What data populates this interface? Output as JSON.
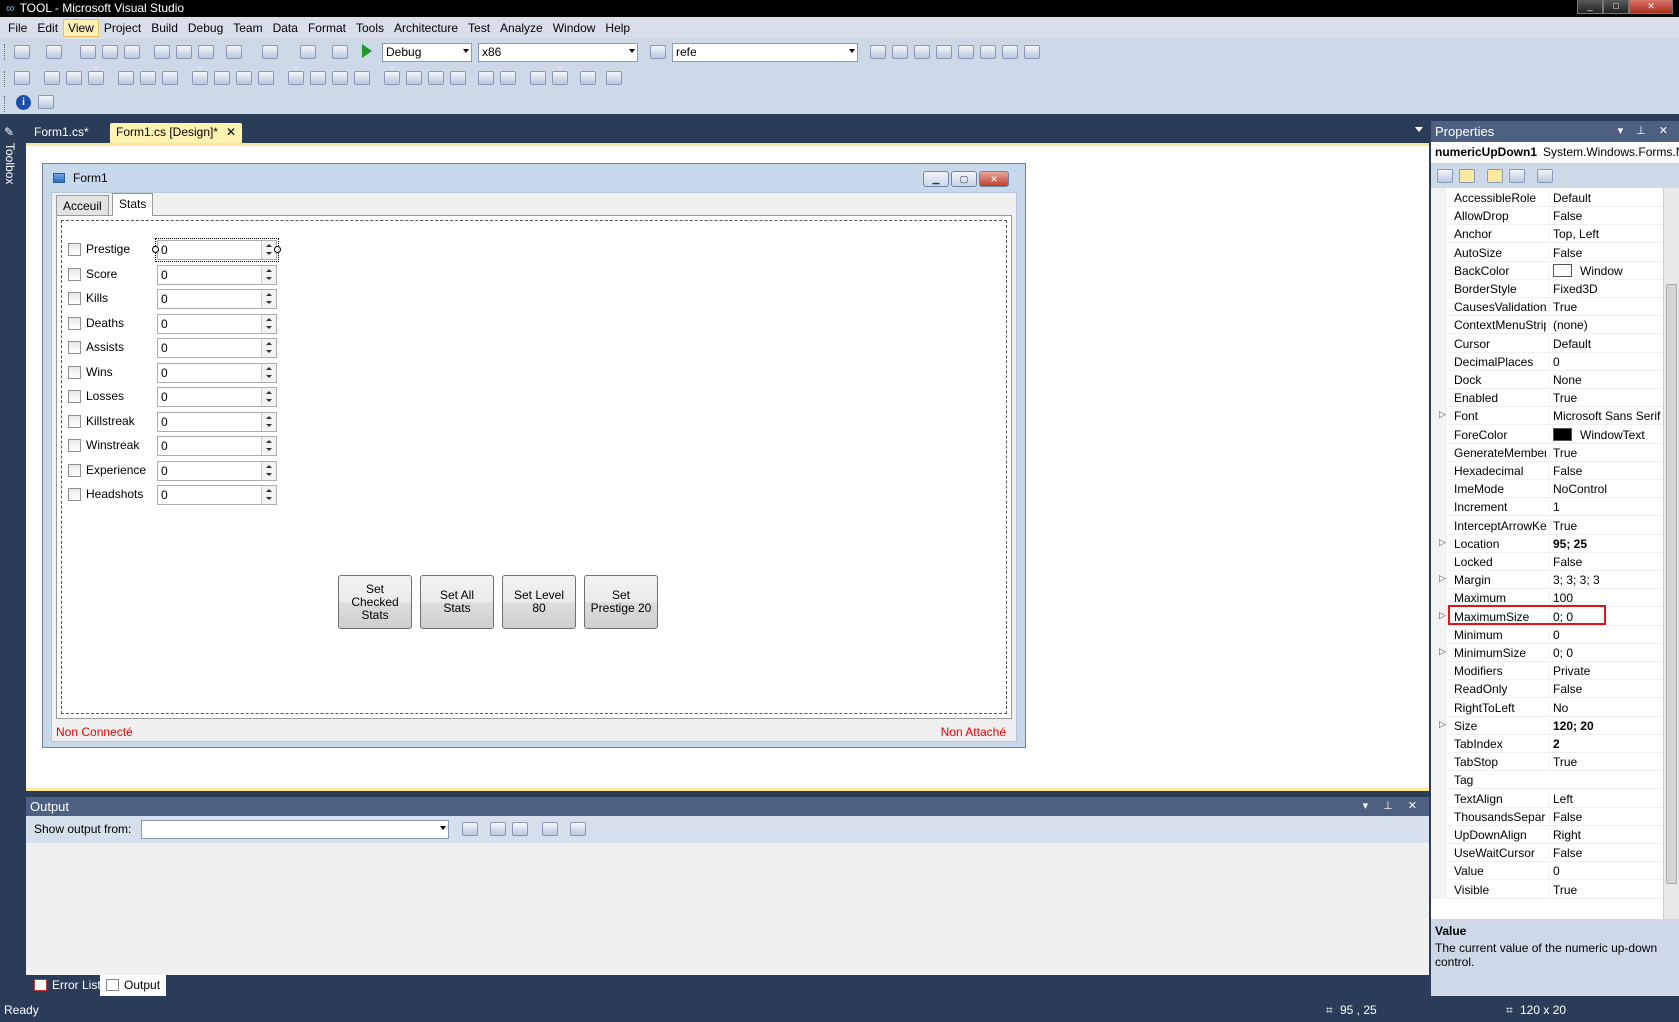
{
  "window": {
    "title": "TOOL - Microsoft Visual Studio",
    "min": "_",
    "max": "□",
    "close": "✕"
  },
  "menu": [
    "File",
    "Edit",
    "View",
    "Project",
    "Build",
    "Debug",
    "Team",
    "Data",
    "Format",
    "Tools",
    "Architecture",
    "Test",
    "Analyze",
    "Window",
    "Help"
  ],
  "menu_active": "View",
  "toolbar": {
    "config": "Debug",
    "platform": "x86",
    "find": "refe"
  },
  "toolbox_label": "Toolbox",
  "doc_tabs": [
    {
      "label": "Form1.cs*"
    },
    {
      "label": "Form1.cs [Design]*",
      "close": "✕"
    }
  ],
  "form": {
    "title": "Form1",
    "tabs": [
      "Acceuil",
      "Stats"
    ],
    "rows": [
      {
        "label": "Prestige",
        "value": "0"
      },
      {
        "label": "Score",
        "value": "0"
      },
      {
        "label": "Kills",
        "value": "0"
      },
      {
        "label": "Deaths",
        "value": "0"
      },
      {
        "label": "Assists",
        "value": "0"
      },
      {
        "label": "Wins",
        "value": "0"
      },
      {
        "label": "Losses",
        "value": "0"
      },
      {
        "label": "Killstreak",
        "value": "0"
      },
      {
        "label": "Winstreak",
        "value": "0"
      },
      {
        "label": "Experience",
        "value": "0"
      },
      {
        "label": "Headshots",
        "value": "0"
      }
    ],
    "buttons": [
      "Set Checked Stats",
      "Set All Stats",
      "Set Level 80",
      "Set Prestige 20"
    ],
    "status_left": "Non Connecté",
    "status_right": "Non Attaché"
  },
  "output": {
    "title": "Output",
    "show_from": "Show output from:",
    "ctrl": "▾ ⊥ ✕"
  },
  "bottom_tabs": [
    "Error List",
    "Output"
  ],
  "status": {
    "ready": "Ready",
    "position": "95 , 25",
    "size": "120 x 20"
  },
  "properties": {
    "title": "Properties",
    "ctrl": "▾ ⊥ ✕",
    "object_name": "numericUpDown1",
    "object_type": "System.Windows.Forms.NumericUpDown",
    "rows": [
      {
        "name": "AccessibleRole",
        "value": "Default"
      },
      {
        "name": "AllowDrop",
        "value": "False"
      },
      {
        "name": "Anchor",
        "value": "Top, Left"
      },
      {
        "name": "AutoSize",
        "value": "False"
      },
      {
        "name": "BackColor",
        "value": "Window",
        "swatch": "#ffffff"
      },
      {
        "name": "BorderStyle",
        "value": "Fixed3D"
      },
      {
        "name": "CausesValidation",
        "value": "True"
      },
      {
        "name": "ContextMenuStrip",
        "value": "(none)"
      },
      {
        "name": "Cursor",
        "value": "Default"
      },
      {
        "name": "DecimalPlaces",
        "value": "0"
      },
      {
        "name": "Dock",
        "value": "None"
      },
      {
        "name": "Enabled",
        "value": "True"
      },
      {
        "name": "Font",
        "value": "Microsoft Sans Serif",
        "expand": true
      },
      {
        "name": "ForeColor",
        "value": "WindowText",
        "swatch": "#000000"
      },
      {
        "name": "GenerateMember",
        "value": "True"
      },
      {
        "name": "Hexadecimal",
        "value": "False"
      },
      {
        "name": "ImeMode",
        "value": "NoControl"
      },
      {
        "name": "Increment",
        "value": "1"
      },
      {
        "name": "InterceptArrowKeys",
        "value": "True"
      },
      {
        "name": "Location",
        "value": "95; 25",
        "bold": true,
        "expand": true
      },
      {
        "name": "Locked",
        "value": "False"
      },
      {
        "name": "Margin",
        "value": "3; 3; 3; 3",
        "expand": true
      },
      {
        "name": "Maximum",
        "value": "100"
      },
      {
        "name": "MaximumSize",
        "value": "0; 0",
        "expand": true
      },
      {
        "name": "Minimum",
        "value": "0"
      },
      {
        "name": "MinimumSize",
        "value": "0; 0",
        "expand": true
      },
      {
        "name": "Modifiers",
        "value": "Private"
      },
      {
        "name": "ReadOnly",
        "value": "False"
      },
      {
        "name": "RightToLeft",
        "value": "No"
      },
      {
        "name": "Size",
        "value": "120; 20",
        "bold": true,
        "expand": true
      },
      {
        "name": "TabIndex",
        "value": "2",
        "bold": true
      },
      {
        "name": "TabStop",
        "value": "True"
      },
      {
        "name": "Tag",
        "value": ""
      },
      {
        "name": "TextAlign",
        "value": "Left"
      },
      {
        "name": "ThousandsSeparator",
        "value": "False"
      },
      {
        "name": "UpDownAlign",
        "value": "Right"
      },
      {
        "name": "UseWaitCursor",
        "value": "False"
      },
      {
        "name": "Value",
        "value": "0"
      },
      {
        "name": "Visible",
        "value": "True"
      }
    ],
    "desc_title": "Value",
    "desc_text": "The current value of the numeric up-down control."
  }
}
